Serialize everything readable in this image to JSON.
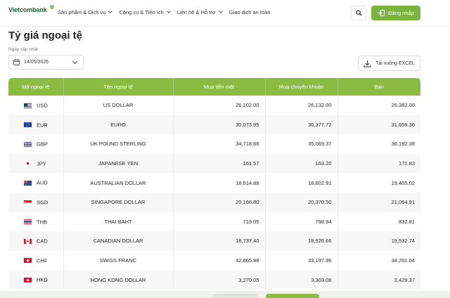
{
  "header": {
    "logo_text": "Vietcombank",
    "nav": [
      "Sản phẩm & Dịch vụ",
      "Công cụ & Tiện ích",
      "Liên hệ & Hỗ trợ",
      "Giao dịch an toàn"
    ],
    "login_label": "Đăng nhập"
  },
  "page": {
    "title": "Tỷ giá ngoại tệ",
    "date_label": "Ngày cập nhật",
    "date_value": "14/05/2026",
    "excel_label": "Tải xuống EXCEL"
  },
  "table": {
    "headers": [
      "Mã ngoại tệ",
      "Tên ngoại tệ",
      "Mua tiền mặt",
      "Mua chuyển khoản",
      "Bán"
    ],
    "rows": [
      {
        "code": "USD",
        "name": "US DOLLAR",
        "cash": "26,102.00",
        "transfer": "26,132.00",
        "sell": "26,382.00",
        "flag": "us"
      },
      {
        "code": "EUR",
        "name": "EURO",
        "cash": "30,073.95",
        "transfer": "30,377.72",
        "sell": "31,659.36",
        "flag": "eu"
      },
      {
        "code": "GBP",
        "name": "UK POUND STERLING",
        "cash": "34,718.68",
        "transfer": "35,069.37",
        "sell": "36,192.38",
        "flag": "gb"
      },
      {
        "code": "JPY",
        "name": "JAPANESE YEN",
        "cash": "161.57",
        "transfer": "163.20",
        "sell": "171.83",
        "flag": "jp"
      },
      {
        "code": "AUD",
        "name": "AUSTRALIAN DOLLAR",
        "cash": "18,614.88",
        "transfer": "18,802.91",
        "sell": "19,405.02",
        "flag": "au"
      },
      {
        "code": "SGD",
        "name": "SINGAPORE DOLLAR",
        "cash": "20,166.80",
        "transfer": "20,370.50",
        "sell": "21,064.91",
        "flag": "sg"
      },
      {
        "code": "THB",
        "name": "THAI BAHT",
        "cash": "719.05",
        "transfer": "798.94",
        "sell": "832.81",
        "flag": "th"
      },
      {
        "code": "CAD",
        "name": "CANADIAN DOLLAR",
        "cash": "18,737.40",
        "transfer": "18,926.66",
        "sell": "19,532.74",
        "flag": "ca"
      },
      {
        "code": "CHF",
        "name": "SWISS FRANC",
        "cash": "32,865.98",
        "transfer": "33,197.96",
        "sell": "34,261.04",
        "flag": "ch"
      },
      {
        "code": "HKD",
        "name": "HONG KONG DOLLAR",
        "cash": "3,270.05",
        "transfer": "3,303.08",
        "sell": "3,429.37",
        "flag": "hk"
      }
    ]
  },
  "colors": {
    "accent": "#8cbb44",
    "brand": "#1a5e2c",
    "button": "#7ab43c"
  }
}
